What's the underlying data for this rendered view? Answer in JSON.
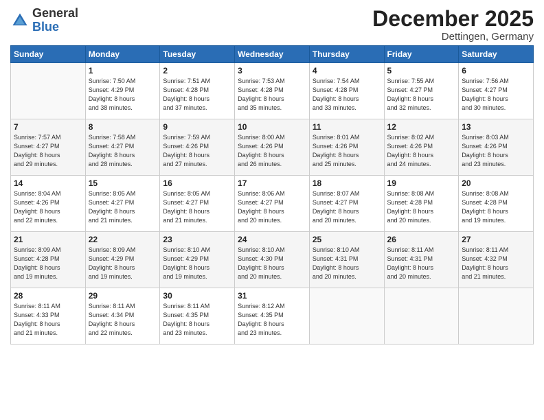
{
  "header": {
    "logo_general": "General",
    "logo_blue": "Blue",
    "month_title": "December 2025",
    "location": "Dettingen, Germany"
  },
  "days_of_week": [
    "Sunday",
    "Monday",
    "Tuesday",
    "Wednesday",
    "Thursday",
    "Friday",
    "Saturday"
  ],
  "weeks": [
    [
      {
        "day": "",
        "info": ""
      },
      {
        "day": "1",
        "info": "Sunrise: 7:50 AM\nSunset: 4:29 PM\nDaylight: 8 hours\nand 38 minutes."
      },
      {
        "day": "2",
        "info": "Sunrise: 7:51 AM\nSunset: 4:28 PM\nDaylight: 8 hours\nand 37 minutes."
      },
      {
        "day": "3",
        "info": "Sunrise: 7:53 AM\nSunset: 4:28 PM\nDaylight: 8 hours\nand 35 minutes."
      },
      {
        "day": "4",
        "info": "Sunrise: 7:54 AM\nSunset: 4:28 PM\nDaylight: 8 hours\nand 33 minutes."
      },
      {
        "day": "5",
        "info": "Sunrise: 7:55 AM\nSunset: 4:27 PM\nDaylight: 8 hours\nand 32 minutes."
      },
      {
        "day": "6",
        "info": "Sunrise: 7:56 AM\nSunset: 4:27 PM\nDaylight: 8 hours\nand 30 minutes."
      }
    ],
    [
      {
        "day": "7",
        "info": "Sunrise: 7:57 AM\nSunset: 4:27 PM\nDaylight: 8 hours\nand 29 minutes."
      },
      {
        "day": "8",
        "info": "Sunrise: 7:58 AM\nSunset: 4:27 PM\nDaylight: 8 hours\nand 28 minutes."
      },
      {
        "day": "9",
        "info": "Sunrise: 7:59 AM\nSunset: 4:26 PM\nDaylight: 8 hours\nand 27 minutes."
      },
      {
        "day": "10",
        "info": "Sunrise: 8:00 AM\nSunset: 4:26 PM\nDaylight: 8 hours\nand 26 minutes."
      },
      {
        "day": "11",
        "info": "Sunrise: 8:01 AM\nSunset: 4:26 PM\nDaylight: 8 hours\nand 25 minutes."
      },
      {
        "day": "12",
        "info": "Sunrise: 8:02 AM\nSunset: 4:26 PM\nDaylight: 8 hours\nand 24 minutes."
      },
      {
        "day": "13",
        "info": "Sunrise: 8:03 AM\nSunset: 4:26 PM\nDaylight: 8 hours\nand 23 minutes."
      }
    ],
    [
      {
        "day": "14",
        "info": "Sunrise: 8:04 AM\nSunset: 4:26 PM\nDaylight: 8 hours\nand 22 minutes."
      },
      {
        "day": "15",
        "info": "Sunrise: 8:05 AM\nSunset: 4:27 PM\nDaylight: 8 hours\nand 21 minutes."
      },
      {
        "day": "16",
        "info": "Sunrise: 8:05 AM\nSunset: 4:27 PM\nDaylight: 8 hours\nand 21 minutes."
      },
      {
        "day": "17",
        "info": "Sunrise: 8:06 AM\nSunset: 4:27 PM\nDaylight: 8 hours\nand 20 minutes."
      },
      {
        "day": "18",
        "info": "Sunrise: 8:07 AM\nSunset: 4:27 PM\nDaylight: 8 hours\nand 20 minutes."
      },
      {
        "day": "19",
        "info": "Sunrise: 8:08 AM\nSunset: 4:28 PM\nDaylight: 8 hours\nand 20 minutes."
      },
      {
        "day": "20",
        "info": "Sunrise: 8:08 AM\nSunset: 4:28 PM\nDaylight: 8 hours\nand 19 minutes."
      }
    ],
    [
      {
        "day": "21",
        "info": "Sunrise: 8:09 AM\nSunset: 4:28 PM\nDaylight: 8 hours\nand 19 minutes."
      },
      {
        "day": "22",
        "info": "Sunrise: 8:09 AM\nSunset: 4:29 PM\nDaylight: 8 hours\nand 19 minutes."
      },
      {
        "day": "23",
        "info": "Sunrise: 8:10 AM\nSunset: 4:29 PM\nDaylight: 8 hours\nand 19 minutes."
      },
      {
        "day": "24",
        "info": "Sunrise: 8:10 AM\nSunset: 4:30 PM\nDaylight: 8 hours\nand 20 minutes."
      },
      {
        "day": "25",
        "info": "Sunrise: 8:10 AM\nSunset: 4:31 PM\nDaylight: 8 hours\nand 20 minutes."
      },
      {
        "day": "26",
        "info": "Sunrise: 8:11 AM\nSunset: 4:31 PM\nDaylight: 8 hours\nand 20 minutes."
      },
      {
        "day": "27",
        "info": "Sunrise: 8:11 AM\nSunset: 4:32 PM\nDaylight: 8 hours\nand 21 minutes."
      }
    ],
    [
      {
        "day": "28",
        "info": "Sunrise: 8:11 AM\nSunset: 4:33 PM\nDaylight: 8 hours\nand 21 minutes."
      },
      {
        "day": "29",
        "info": "Sunrise: 8:11 AM\nSunset: 4:34 PM\nDaylight: 8 hours\nand 22 minutes."
      },
      {
        "day": "30",
        "info": "Sunrise: 8:11 AM\nSunset: 4:35 PM\nDaylight: 8 hours\nand 23 minutes."
      },
      {
        "day": "31",
        "info": "Sunrise: 8:12 AM\nSunset: 4:35 PM\nDaylight: 8 hours\nand 23 minutes."
      },
      {
        "day": "",
        "info": ""
      },
      {
        "day": "",
        "info": ""
      },
      {
        "day": "",
        "info": ""
      }
    ]
  ]
}
